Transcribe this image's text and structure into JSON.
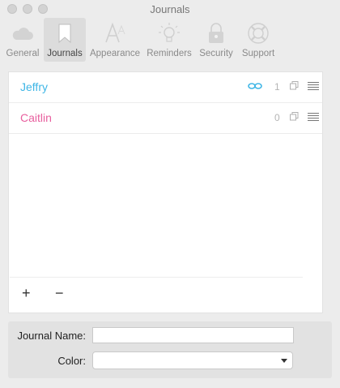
{
  "window": {
    "title": "Journals"
  },
  "toolbar": [
    {
      "id": "general",
      "label": "General",
      "icon": "cloud-icon",
      "active": false
    },
    {
      "id": "journals",
      "label": "Journals",
      "icon": "bookmark-icon",
      "active": true
    },
    {
      "id": "appearance",
      "label": "Appearance",
      "icon": "font-icon",
      "active": false
    },
    {
      "id": "reminders",
      "label": "Reminders",
      "icon": "lightbulb-icon",
      "active": false
    },
    {
      "id": "security",
      "label": "Security",
      "icon": "lock-icon",
      "active": false
    },
    {
      "id": "support",
      "label": "Support",
      "icon": "lifebuoy-icon",
      "active": false
    }
  ],
  "journals": [
    {
      "name": "Jeffry",
      "count": "1",
      "color": "#3fb6e6",
      "linked": true
    },
    {
      "name": "Caitlin",
      "count": "0",
      "color": "#e8609f",
      "linked": false
    }
  ],
  "footer": {
    "add": "+",
    "remove": "−"
  },
  "form": {
    "name_label": "Journal Name:",
    "name_value": "",
    "color_label": "Color:",
    "color_value": ""
  }
}
